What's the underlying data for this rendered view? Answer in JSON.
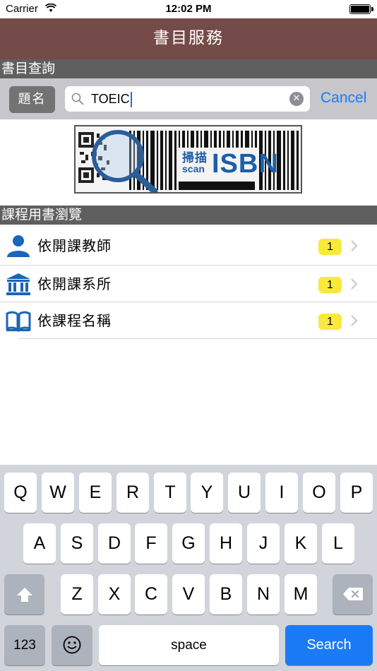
{
  "status_bar": {
    "carrier": "Carrier",
    "time": "12:02 PM"
  },
  "nav": {
    "title": "書目服務"
  },
  "search_section": {
    "header": "書目查詢"
  },
  "search": {
    "scope_label": "題名",
    "value": "TOEIC",
    "cancel_label": "Cancel"
  },
  "scan_banner": {
    "label_cn": "掃描",
    "label_en": "scan",
    "label_isbn": "ISBN"
  },
  "browse_section": {
    "header": "課程用書瀏覽"
  },
  "browse_items": [
    {
      "label": "依開課教師",
      "count": "1",
      "icon": "person-icon"
    },
    {
      "label": "依開課系所",
      "count": "1",
      "icon": "building-icon"
    },
    {
      "label": "依課程名稱",
      "count": "1",
      "icon": "book-icon"
    }
  ],
  "keyboard": {
    "row1": [
      "Q",
      "W",
      "E",
      "R",
      "T",
      "Y",
      "U",
      "I",
      "O",
      "P"
    ],
    "row2": [
      "A",
      "S",
      "D",
      "F",
      "G",
      "H",
      "J",
      "K",
      "L"
    ],
    "row3": [
      "Z",
      "X",
      "C",
      "V",
      "B",
      "N",
      "M"
    ],
    "numbers_label": "123",
    "space_label": "space",
    "search_label": "Search"
  },
  "colors": {
    "nav_background": "#744b48",
    "section_header": "#5f5f5f",
    "accent_blue": "#1b7bf6",
    "badge_yellow": "#f9e93a"
  }
}
